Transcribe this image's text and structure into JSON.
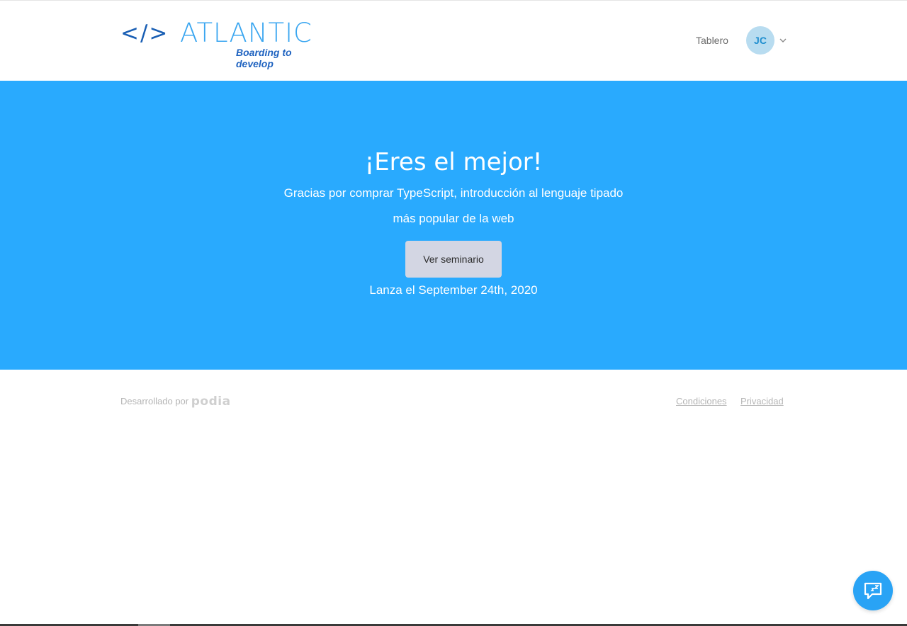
{
  "header": {
    "logo_brackets": "</>",
    "logo_wordmark": "ATLANTIC",
    "logo_tagline": "Boarding to develop",
    "nav_link": "Tablero",
    "avatar_initials": "JC"
  },
  "hero": {
    "title": "¡Eres el mejor!",
    "subtitle": "Gracias por comprar TypeScript, introducción al lenguaje tipado más popular de la web",
    "cta_label": "Ver seminario",
    "launch_text": "Lanza el September 24th, 2020"
  },
  "footer": {
    "powered_by": "Desarrollado por",
    "brand": "podia",
    "links": [
      "Condiciones",
      "Privacidad"
    ]
  },
  "colors": {
    "hero_bg": "#29aafe",
    "button_bg": "#d3d6e3",
    "avatar_bg": "#b8dcf0",
    "chat_bg": "#29a3f5"
  },
  "icons": {
    "chat": "chat-support-icon",
    "dropdown": "chevron-down-icon"
  }
}
